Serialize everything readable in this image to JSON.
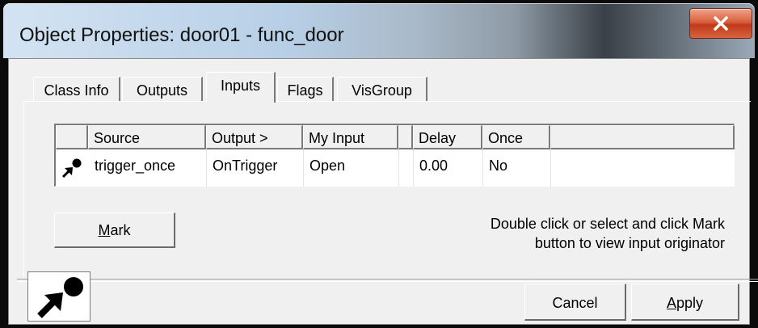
{
  "window": {
    "title": "Object Properties: door01 - func_door",
    "close_icon": "close-icon"
  },
  "tabs": [
    {
      "label": "Class Info"
    },
    {
      "label": "Outputs"
    },
    {
      "label": "Inputs",
      "active": true
    },
    {
      "label": "Flags"
    },
    {
      "label": "VisGroup"
    }
  ],
  "inputs_list": {
    "columns": [
      "Source",
      "Output >",
      "My Input",
      "",
      "Delay",
      "Once",
      ""
    ],
    "rows": [
      {
        "icon": "input-connection-icon",
        "source": "trigger_once",
        "output": "OnTrigger",
        "my_input": "Open",
        "delay": "0.00",
        "once": "No"
      }
    ]
  },
  "mark_button": {
    "label_prefix": "",
    "label_underlined": "M",
    "label_rest": "ark"
  },
  "hint_text": {
    "line1": "Double click or select and click Mark",
    "line2": "button to view input originator"
  },
  "footer": {
    "cancel_label": "Cancel",
    "apply_underlined": "A",
    "apply_rest": "pply",
    "mode_icon": "input-connection-icon"
  }
}
